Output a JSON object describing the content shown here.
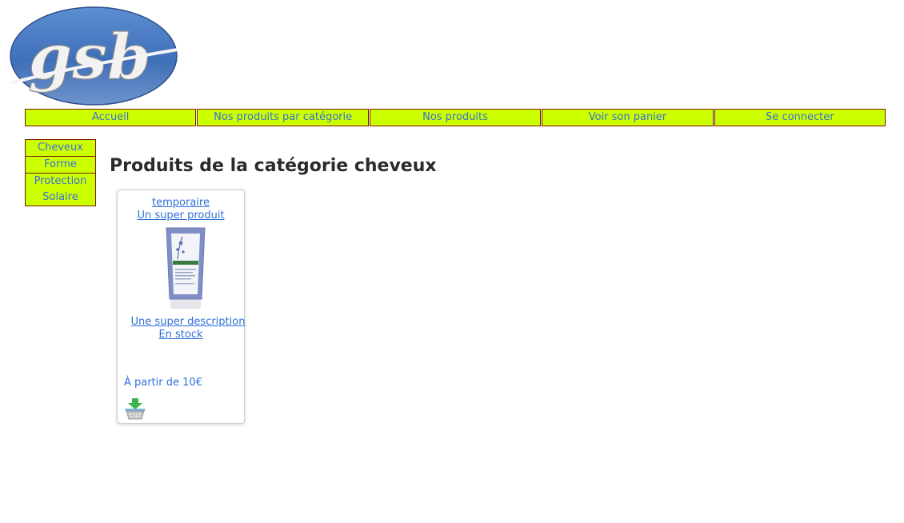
{
  "logo": {
    "text": "gsb"
  },
  "nav": {
    "items": [
      {
        "label": "Accueil"
      },
      {
        "label": "Nos produits par catégorie"
      },
      {
        "label": "Nos produits"
      },
      {
        "label": "Voir son panier"
      },
      {
        "label": "Se connecter"
      }
    ]
  },
  "categories": {
    "items": [
      {
        "label": "Cheveux"
      },
      {
        "label": "Forme"
      },
      {
        "label": "Protection Solaire"
      }
    ]
  },
  "page": {
    "title": "Produits de la catégorie cheveux"
  },
  "product": {
    "name": "temporaire",
    "subtitle": "Un super produit",
    "description": "Une super description",
    "stock": "En stock",
    "price": "À partir de 10€"
  },
  "colors": {
    "nav_bg": "#ccff00",
    "nav_border": "#7a1a00",
    "link": "#2f6fd8",
    "logo_blue": "#4a7bc0"
  },
  "icons": {
    "basket": "add-to-basket-icon",
    "product": "product-image"
  }
}
